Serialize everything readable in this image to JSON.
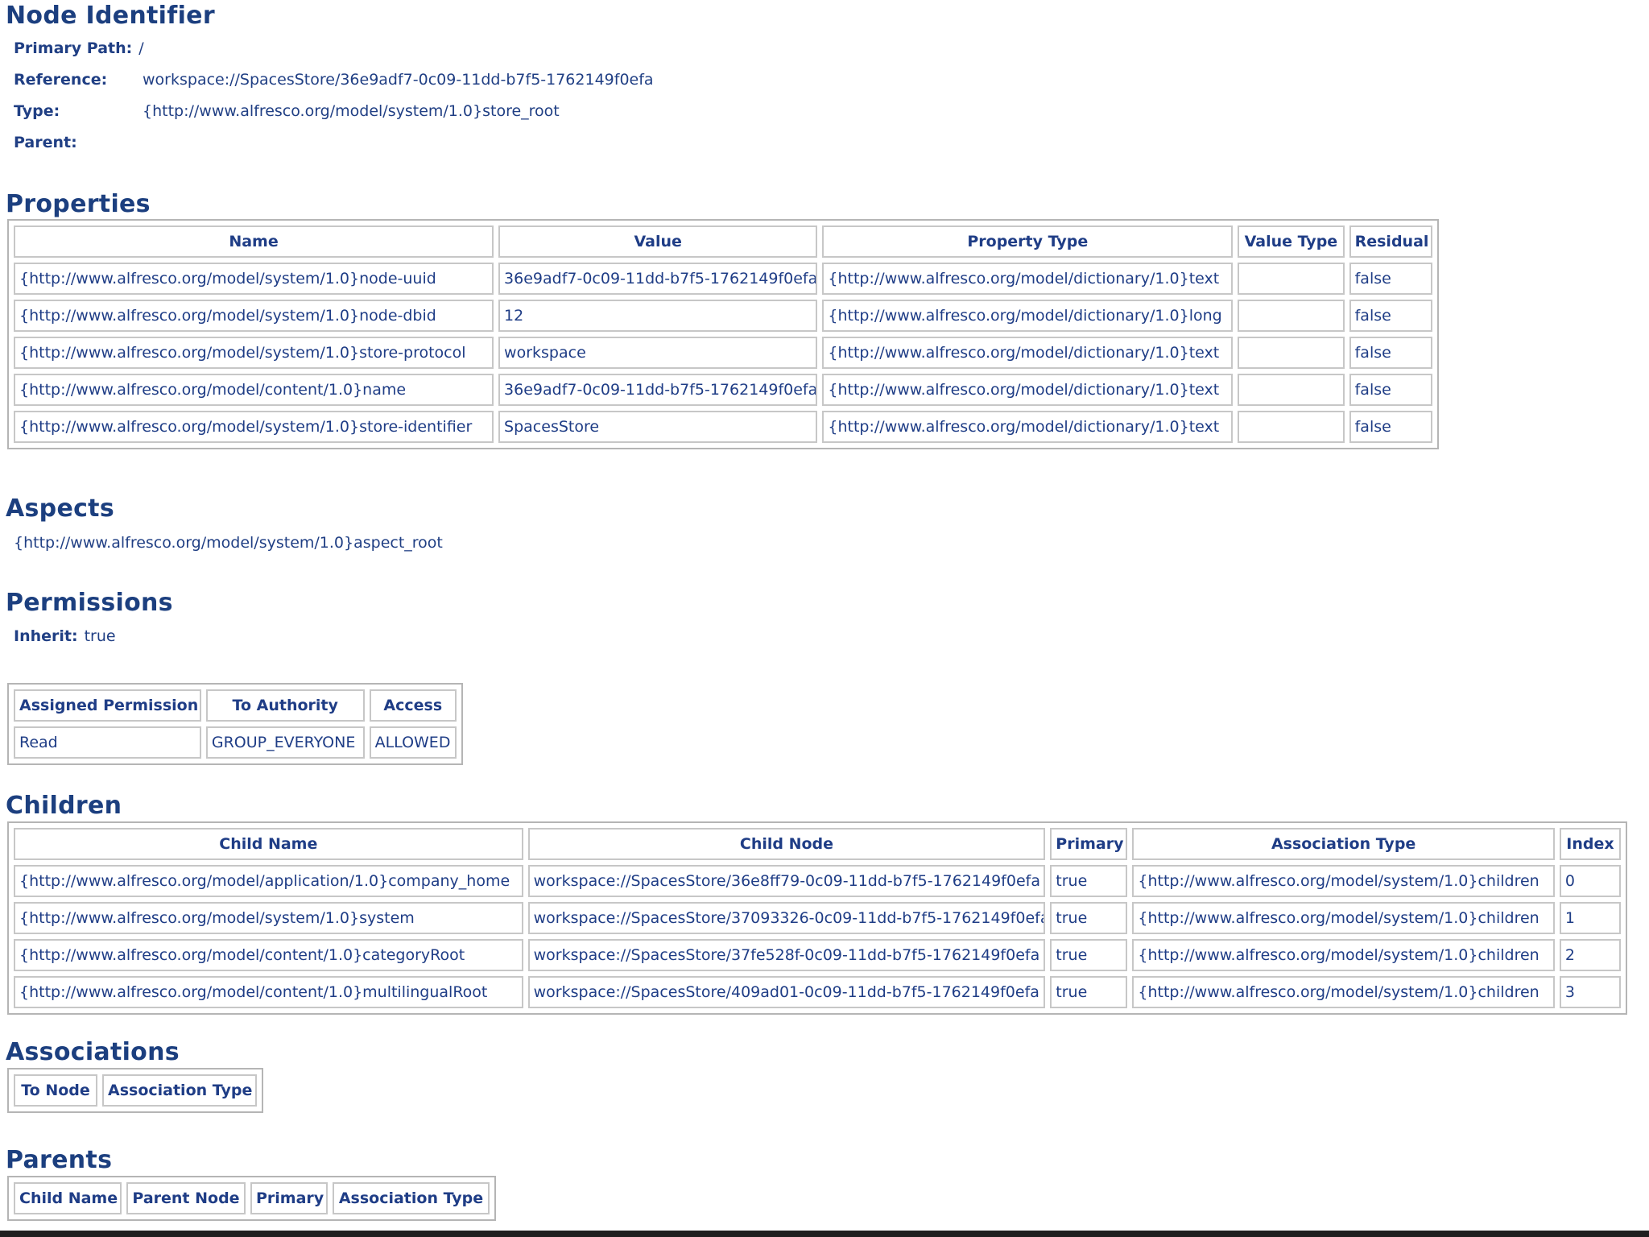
{
  "node_identifier": {
    "title": "Node Identifier",
    "primary_path_label": "Primary Path:",
    "primary_path_value": "/",
    "reference_label": "Reference:",
    "reference_value": "workspace://SpacesStore/36e9adf7-0c09-11dd-b7f5-1762149f0efa",
    "type_label": "Type:",
    "type_value": "{http://www.alfresco.org/model/system/1.0}store_root",
    "parent_label": "Parent:",
    "parent_value": ""
  },
  "properties": {
    "title": "Properties",
    "headers": [
      "Name",
      "Value",
      "Property Type",
      "Value Type",
      "Residual"
    ],
    "rows": [
      [
        "{http://www.alfresco.org/model/system/1.0}node-uuid",
        "36e9adf7-0c09-11dd-b7f5-1762149f0efa",
        "{http://www.alfresco.org/model/dictionary/1.0}text",
        "",
        "false"
      ],
      [
        "{http://www.alfresco.org/model/system/1.0}node-dbid",
        "12",
        "{http://www.alfresco.org/model/dictionary/1.0}long",
        "",
        "false"
      ],
      [
        "{http://www.alfresco.org/model/system/1.0}store-protocol",
        "workspace",
        "{http://www.alfresco.org/model/dictionary/1.0}text",
        "",
        "false"
      ],
      [
        "{http://www.alfresco.org/model/content/1.0}name",
        "36e9adf7-0c09-11dd-b7f5-1762149f0efa",
        "{http://www.alfresco.org/model/dictionary/1.0}text",
        "",
        "false"
      ],
      [
        "{http://www.alfresco.org/model/system/1.0}store-identifier",
        "SpacesStore",
        "{http://www.alfresco.org/model/dictionary/1.0}text",
        "",
        "false"
      ]
    ]
  },
  "aspects": {
    "title": "Aspects",
    "items": [
      "{http://www.alfresco.org/model/system/1.0}aspect_root"
    ]
  },
  "permissions": {
    "title": "Permissions",
    "inherit_label": "Inherit:",
    "inherit_value": "true",
    "headers": [
      "Assigned Permission",
      "To Authority",
      "Access"
    ],
    "rows": [
      [
        "Read",
        "GROUP_EVERYONE",
        "ALLOWED"
      ]
    ]
  },
  "children": {
    "title": "Children",
    "headers": [
      "Child Name",
      "Child Node",
      "Primary",
      "Association Type",
      "Index"
    ],
    "rows": [
      [
        "{http://www.alfresco.org/model/application/1.0}company_home",
        "workspace://SpacesStore/36e8ff79-0c09-11dd-b7f5-1762149f0efa",
        "true",
        "{http://www.alfresco.org/model/system/1.0}children",
        "0"
      ],
      [
        "{http://www.alfresco.org/model/system/1.0}system",
        "workspace://SpacesStore/37093326-0c09-11dd-b7f5-1762149f0efa",
        "true",
        "{http://www.alfresco.org/model/system/1.0}children",
        "1"
      ],
      [
        "{http://www.alfresco.org/model/content/1.0}categoryRoot",
        "workspace://SpacesStore/37fe528f-0c09-11dd-b7f5-1762149f0efa",
        "true",
        "{http://www.alfresco.org/model/system/1.0}children",
        "2"
      ],
      [
        "{http://www.alfresco.org/model/content/1.0}multilingualRoot",
        "workspace://SpacesStore/409ad01-0c09-11dd-b7f5-1762149f0efa",
        "true",
        "{http://www.alfresco.org/model/system/1.0}children",
        "3"
      ]
    ]
  },
  "associations": {
    "title": "Associations",
    "headers": [
      "To Node",
      "Association Type"
    ]
  },
  "parents": {
    "title": "Parents",
    "headers": [
      "Child Name",
      "Parent Node",
      "Primary",
      "Association Type"
    ]
  }
}
